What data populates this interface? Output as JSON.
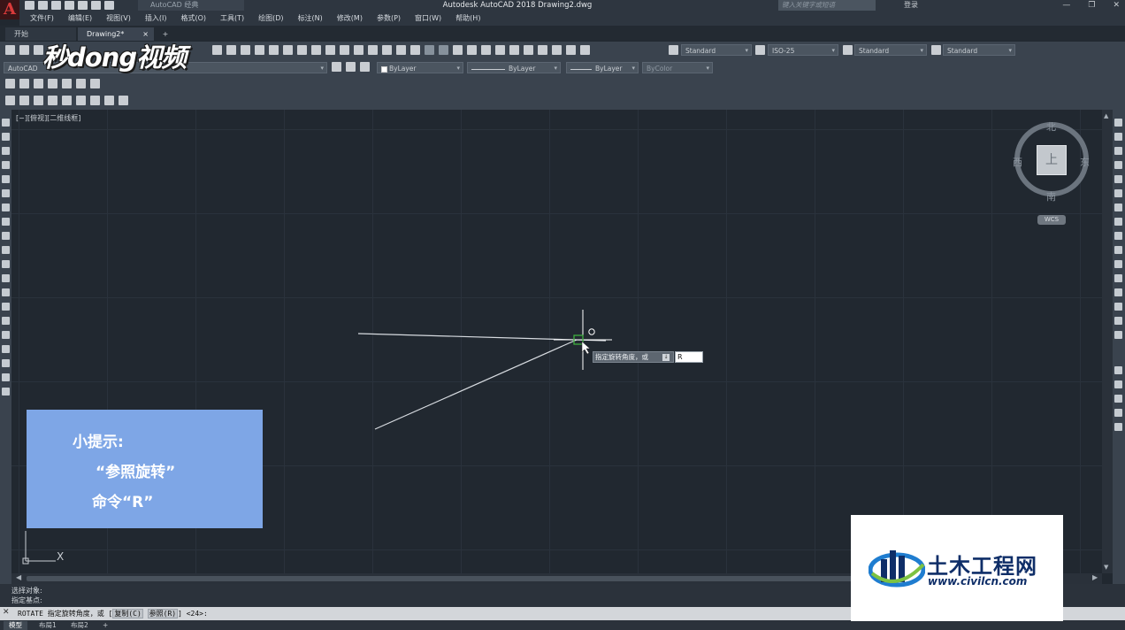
{
  "app": {
    "logo_letter": "A",
    "workspace": "AutoCAD 经典",
    "title": "Autodesk AutoCAD 2018    Drawing2.dwg",
    "search_placeholder": "键入关键字或短语",
    "login": "登录",
    "window_controls": [
      "—",
      "❐",
      "✕"
    ]
  },
  "menu": [
    "文件(F)",
    "编辑(E)",
    "视图(V)",
    "插入(I)",
    "格式(O)",
    "工具(T)",
    "绘图(D)",
    "标注(N)",
    "修改(M)",
    "参数(P)",
    "窗口(W)",
    "帮助(H)"
  ],
  "tabs": {
    "start": "开始",
    "drawing": "Drawing2*",
    "drawing_close": "×",
    "add": "+"
  },
  "toolbar": {
    "text_style": "Standard",
    "dim_style": "ISO-25",
    "table_style": "Standard",
    "mleader_style": "Standard",
    "layer": "AutoCAD",
    "color": "ByLayer",
    "linetype": "ByLayer",
    "lineweight": "ByLayer",
    "plotstyle": "ByColor"
  },
  "watermark": "秒dong视频",
  "viewport_label": "[−][俯视][二维线框]",
  "viewcube": {
    "face": "上",
    "north": "北",
    "south": "南",
    "west": "西",
    "east": "东",
    "wcs": "WCS"
  },
  "dynamic_input": {
    "prompt": "指定旋转角度，或",
    "prompt_btn": "↓",
    "value": "R"
  },
  "tip": {
    "title": "小提示:",
    "line1": "“参照旋转”",
    "line2": "命令“R”"
  },
  "ucs_x": "X",
  "command": {
    "history": [
      "选择对象:",
      "指定基点:"
    ],
    "current_prefix": "ROTATE 指定旋转角度，或 [",
    "opt_copy": "复制(C)",
    "opt_ref": "参照(R)",
    "current_suffix": "] <24>:"
  },
  "layout_tabs": [
    "模型",
    "布局1",
    "布局2",
    "+"
  ],
  "civil_logo": {
    "cn": "土木工程网",
    "url": "www.civilcn.com"
  },
  "colors": {
    "canvas_bg": "#212830",
    "ribbon_bg": "#3a434e",
    "tip_bg": "#7ea6e6",
    "accent_red": "#d83a3a",
    "grip_green": "#3fae3f"
  }
}
